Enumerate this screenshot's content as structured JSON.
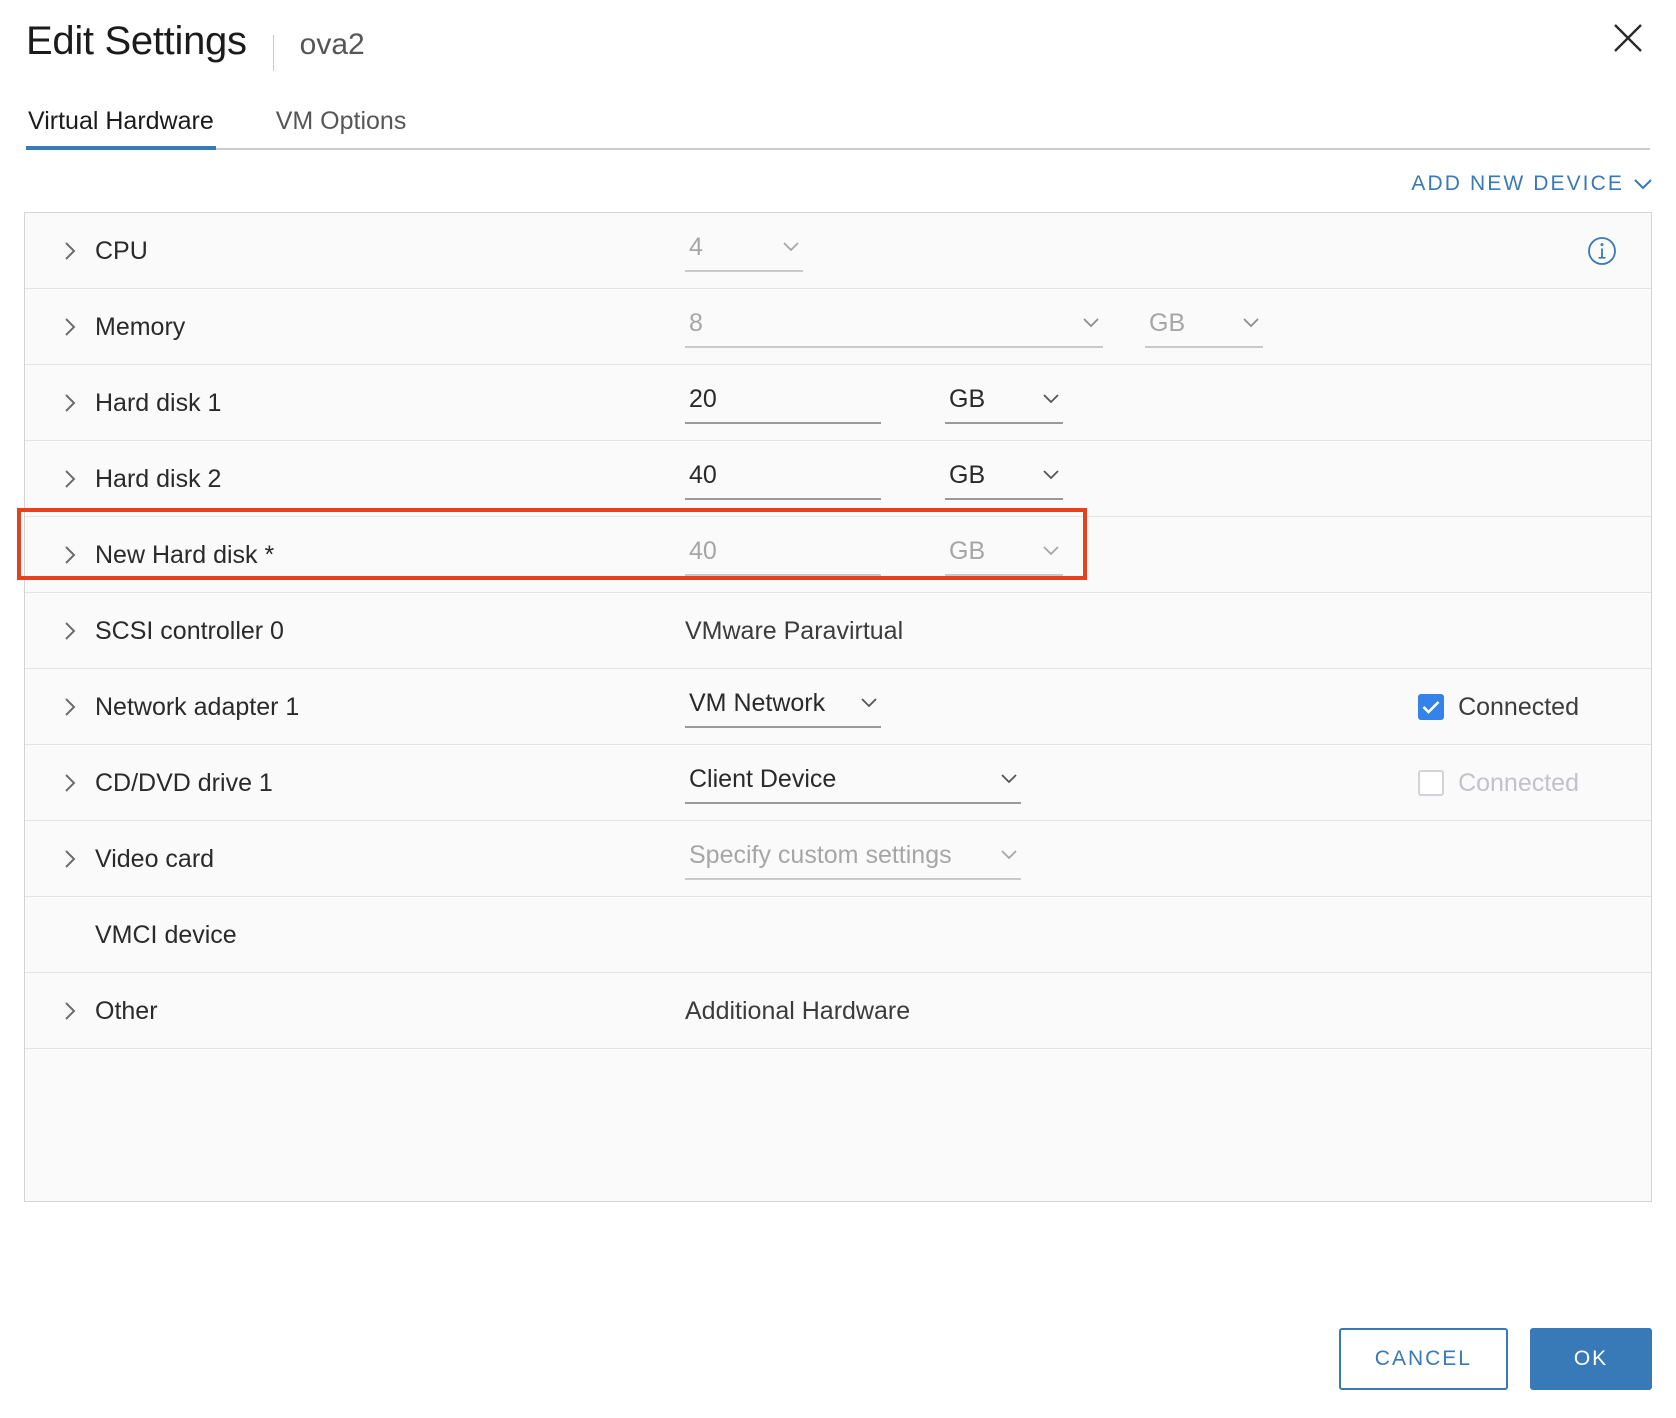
{
  "header": {
    "title": "Edit Settings",
    "subtitle": "ova2",
    "close_icon": "close-icon"
  },
  "tabs": [
    {
      "label": "Virtual Hardware",
      "active": true
    },
    {
      "label": "VM Options",
      "active": false
    }
  ],
  "toolbar": {
    "add_new_device": "ADD NEW DEVICE",
    "add_new_device_icon": "chevron-down-icon"
  },
  "devices": [
    {
      "label": "CPU",
      "value": "4",
      "unit": null,
      "disabled": true,
      "info_icon": "info-icon"
    },
    {
      "label": "Memory",
      "value": "8",
      "unit": "GB",
      "disabled": true
    },
    {
      "label": "Hard disk 1",
      "value": "20",
      "unit": "GB",
      "disabled": false
    },
    {
      "label": "Hard disk 2",
      "value": "40",
      "unit": "GB",
      "disabled": false
    },
    {
      "label": "New Hard disk *",
      "value": "40",
      "unit": "GB",
      "disabled": true,
      "highlighted": true
    },
    {
      "label": "SCSI controller 0",
      "value": "VMware Paravirtual"
    },
    {
      "label": "Network adapter 1",
      "value": "VM Network",
      "checkbox_label": "Connected",
      "checked": true
    },
    {
      "label": "CD/DVD drive 1",
      "value": "Client Device",
      "checkbox_label": "Connected",
      "checked": false,
      "checkbox_disabled": true
    },
    {
      "label": "Video card",
      "value": "Specify custom settings",
      "disabled": true
    },
    {
      "label": "VMCI device",
      "value": ""
    },
    {
      "label": "Other",
      "value": "Additional Hardware"
    }
  ],
  "footer": {
    "cancel_label": "CANCEL",
    "ok_label": "OK"
  },
  "colors": {
    "accent": "#3879b7",
    "highlight": "#e8401f",
    "checkbox_on": "#3583e8"
  }
}
